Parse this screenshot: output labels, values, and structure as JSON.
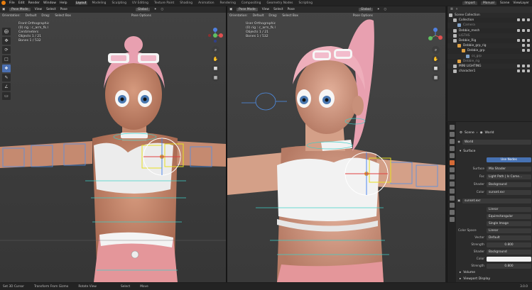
{
  "topbar": {
    "menus": [
      "File",
      "Edit",
      "Render",
      "Window",
      "Help"
    ],
    "workspaces": [
      "Layout",
      "Modeling",
      "Sculpting",
      "UV Editing",
      "Texture Paint",
      "Shading",
      "Animation",
      "Rendering",
      "Compositing",
      "Geometry Nodes",
      "Scripting"
    ],
    "active_workspace": "Layout",
    "right": {
      "import": "Import",
      "manual": "Manual",
      "scene": "Scene",
      "view_layer": "ViewLayer"
    }
  },
  "viewport_left": {
    "mode": "Pose Mode",
    "menus": [
      "View",
      "Select",
      "Pose"
    ],
    "pivot": "Global",
    "orientation_label": "Orientation:",
    "orientation_value": "Default",
    "drag_label": "Drag:",
    "drag_value": "Select Box",
    "pose_options": "Pose Options",
    "info_lines": [
      "Front Orthographic",
      "(0) rig : c_arm_fk.l",
      "Centimeters",
      "",
      "Objects   1 / 21",
      "Bones     1 / 532"
    ]
  },
  "viewport_right": {
    "mode": "Pose Mode",
    "menus": [
      "View",
      "Select",
      "Pose"
    ],
    "pivot": "Global",
    "orientation_label": "Orientation:",
    "orientation_value": "Default",
    "drag_label": "Drag:",
    "drag_value": "Select Box",
    "pose_options": "Pose Options",
    "info_lines": [
      "User Orthographic",
      "(0) rig : c_arm_fk.l",
      "",
      "Objects   1 / 21",
      "Bones     1 / 532"
    ]
  },
  "tools": [
    "cursor",
    "move",
    "rotate",
    "scale",
    "transform",
    "annotate",
    "measure",
    "bone-size"
  ],
  "outliner": {
    "header": "Scene Collection",
    "rows": [
      {
        "label": "Scene Collection",
        "dim": false,
        "color": "#b8b8b8"
      },
      {
        "label": "Collection",
        "dim": false,
        "color": "#b8b8b8"
      },
      {
        "label": "Camera",
        "dim": true,
        "color": "#7fa0c8"
      },
      {
        "label": "Debbie_mesh",
        "dim": false,
        "color": "#b8b8b8"
      },
      {
        "label": "LIGTHS",
        "dim": true,
        "color": "#b8b8b8"
      },
      {
        "label": "Debbie_Rig",
        "dim": false,
        "color": "#b8b8b8"
      },
      {
        "label": "Debbie_grp_rig",
        "dim": false,
        "color": "#e0a040"
      },
      {
        "label": "Debbie_grp",
        "dim": false,
        "color": "#e0a040"
      },
      {
        "label": "cs_grp",
        "dim": true,
        "color": "#7fa0c8"
      },
      {
        "label": "Debbie_rig",
        "dim": true,
        "color": "#e0a040"
      },
      {
        "label": "MINI LIGHTING",
        "dim": false,
        "color": "#b8b8b8"
      },
      {
        "label": "character1",
        "dim": false,
        "color": "#b8b8b8"
      }
    ]
  },
  "properties": {
    "breadcrumb_scene": "Scene",
    "breadcrumb_world": "World",
    "world_name": "World",
    "surface_section": "Surface",
    "use_nodes": "Use Nodes",
    "rows": [
      {
        "k": "Surface",
        "v": "Mix Shader"
      },
      {
        "k": "Fac",
        "v": "Light Path | Is Came..."
      },
      {
        "k": "Shader",
        "v": "Background"
      },
      {
        "k": "Color",
        "v": "sunset.exr"
      }
    ],
    "image_name": "sunset.exr",
    "image_opts": [
      "Linear",
      "Equirectangular",
      "Single Image"
    ],
    "color_space_label": "Color Space",
    "color_space": "Linear",
    "vector_label": "Vector",
    "vector_value": "Default",
    "strength_label": "Strength",
    "strength_1": "0.800",
    "shader2_label": "Shader",
    "shader2_value": "Background",
    "color2_label": "Color",
    "strength_2": "0.800",
    "volume_section": "Volume",
    "viewport_display_section": "Viewport Display"
  },
  "statusbar": {
    "items": [
      "Set 3D Cursor",
      "Transform From Gizmo",
      "Rotate View",
      "Select",
      "Move"
    ],
    "version": "3.0.0"
  },
  "colors": {
    "accent": "#4772b3",
    "active_tab": "#d46a36",
    "blender_orange": "#e87d0d"
  }
}
